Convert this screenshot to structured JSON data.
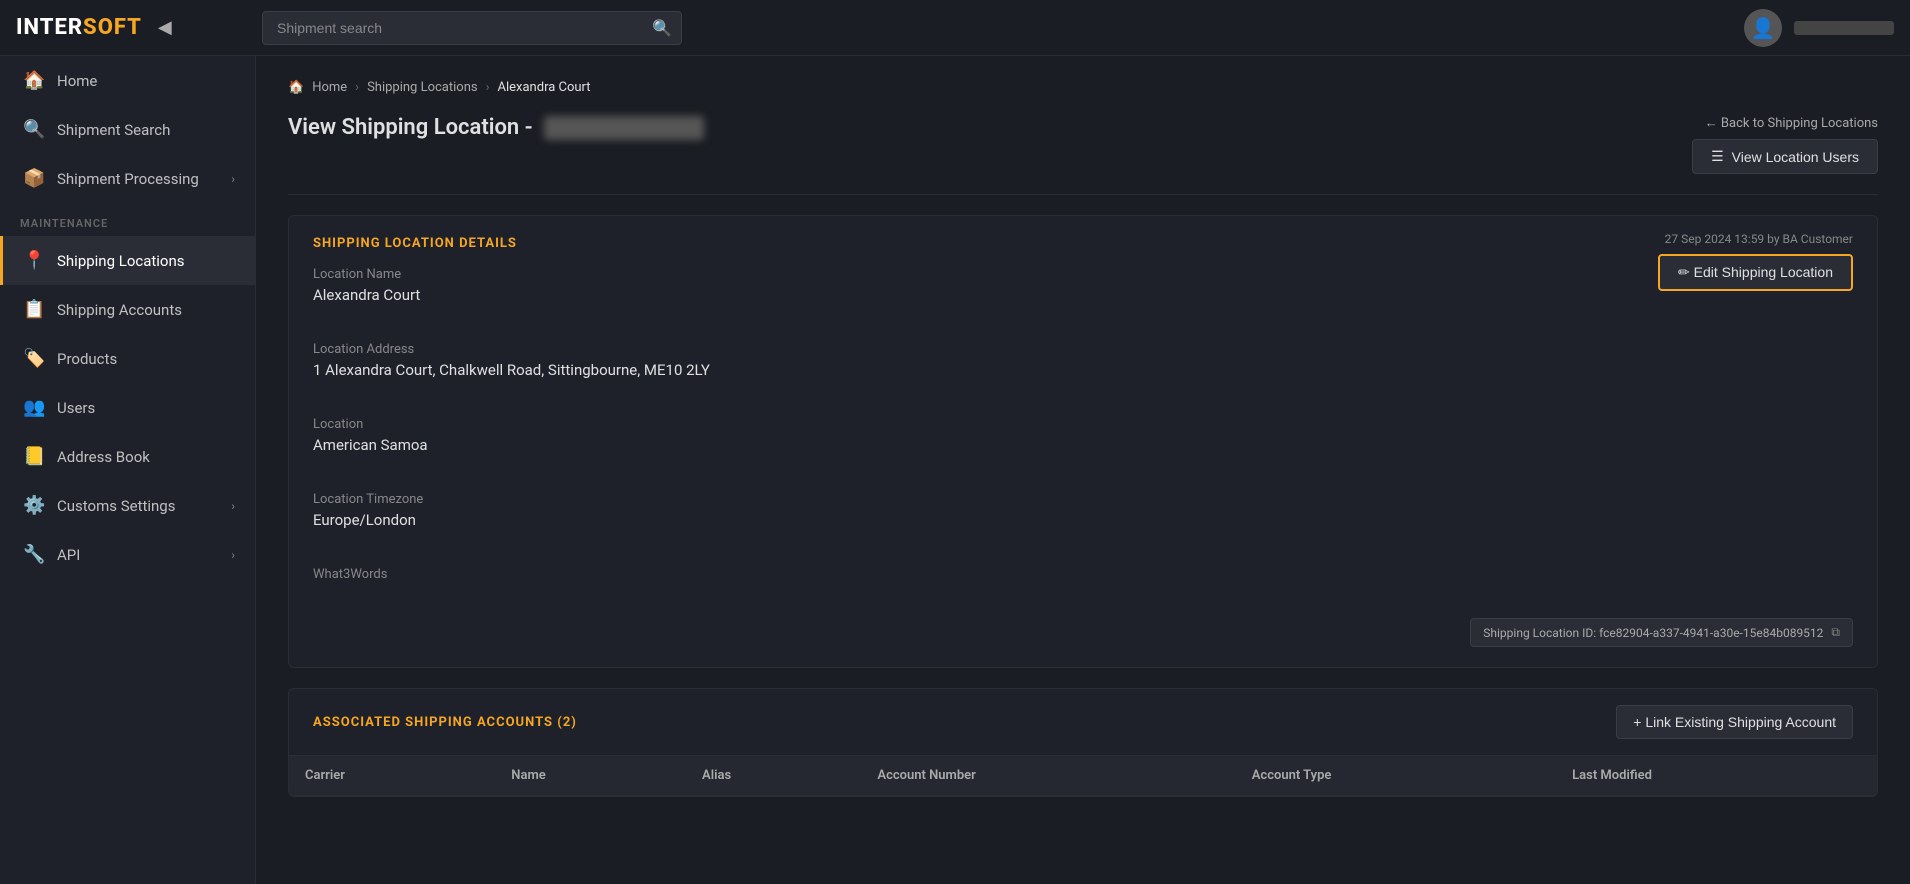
{
  "app": {
    "logo_inter": "INTER",
    "logo_soft": "SOFT"
  },
  "topnav": {
    "search_placeholder": "Shipment search",
    "user_label": "User"
  },
  "sidebar": {
    "items": [
      {
        "id": "home",
        "label": "Home",
        "icon": "🏠",
        "active": false,
        "has_chevron": false
      },
      {
        "id": "shipment-search",
        "label": "Shipment Search",
        "icon": "🔍",
        "active": false,
        "has_chevron": false
      },
      {
        "id": "shipment-processing",
        "label": "Shipment Processing",
        "icon": "📦",
        "active": false,
        "has_chevron": true
      }
    ],
    "maintenance_label": "MAINTENANCE",
    "maintenance_items": [
      {
        "id": "shipping-locations",
        "label": "Shipping Locations",
        "icon": "📍",
        "active": true,
        "has_chevron": false
      },
      {
        "id": "shipping-accounts",
        "label": "Shipping Accounts",
        "icon": "📋",
        "active": false,
        "has_chevron": false
      },
      {
        "id": "products",
        "label": "Products",
        "icon": "🏷️",
        "active": false,
        "has_chevron": false
      },
      {
        "id": "users",
        "label": "Users",
        "icon": "👥",
        "active": false,
        "has_chevron": false
      },
      {
        "id": "address-book",
        "label": "Address Book",
        "icon": "📒",
        "active": false,
        "has_chevron": false
      },
      {
        "id": "customs-settings",
        "label": "Customs Settings",
        "icon": "⚙️",
        "active": false,
        "has_chevron": true
      },
      {
        "id": "api",
        "label": "API",
        "icon": "🔧",
        "active": false,
        "has_chevron": true
      }
    ]
  },
  "breadcrumb": {
    "home": "Home",
    "shipping_locations": "Shipping Locations",
    "current": "Alexandra Court"
  },
  "page": {
    "title": "View Shipping Location -",
    "back_label": "← Back to Shipping Locations",
    "view_users_label": "View Location Users",
    "timestamp": "27 Sep 2024 13:59 by BA Customer",
    "edit_label": "✏ Edit Shipping Location"
  },
  "shipping_location_details": {
    "section_title": "SHIPPING LOCATION DETAILS",
    "fields": [
      {
        "label": "Location Name",
        "value": "Alexandra Court"
      },
      {
        "label": "Location Address",
        "value": "1 Alexandra Court, Chalkwell Road, Sittingbourne, ME10 2LY"
      },
      {
        "label": "Location",
        "value": "American Samoa"
      },
      {
        "label": "Location Timezone",
        "value": "Europe/London"
      },
      {
        "label": "What3Words",
        "value": ""
      }
    ],
    "location_id_label": "Shipping Location ID: fce82904-a337-4941-a30e-15e84b089512",
    "copy_icon": "⧉"
  },
  "associated_accounts": {
    "section_title": "ASSOCIATED SHIPPING ACCOUNTS (2)",
    "link_button_label": "+ Link Existing Shipping Account",
    "table_headers": [
      "Carrier",
      "Name",
      "Alias",
      "Account Number",
      "Account Type",
      "Last Modified"
    ]
  }
}
